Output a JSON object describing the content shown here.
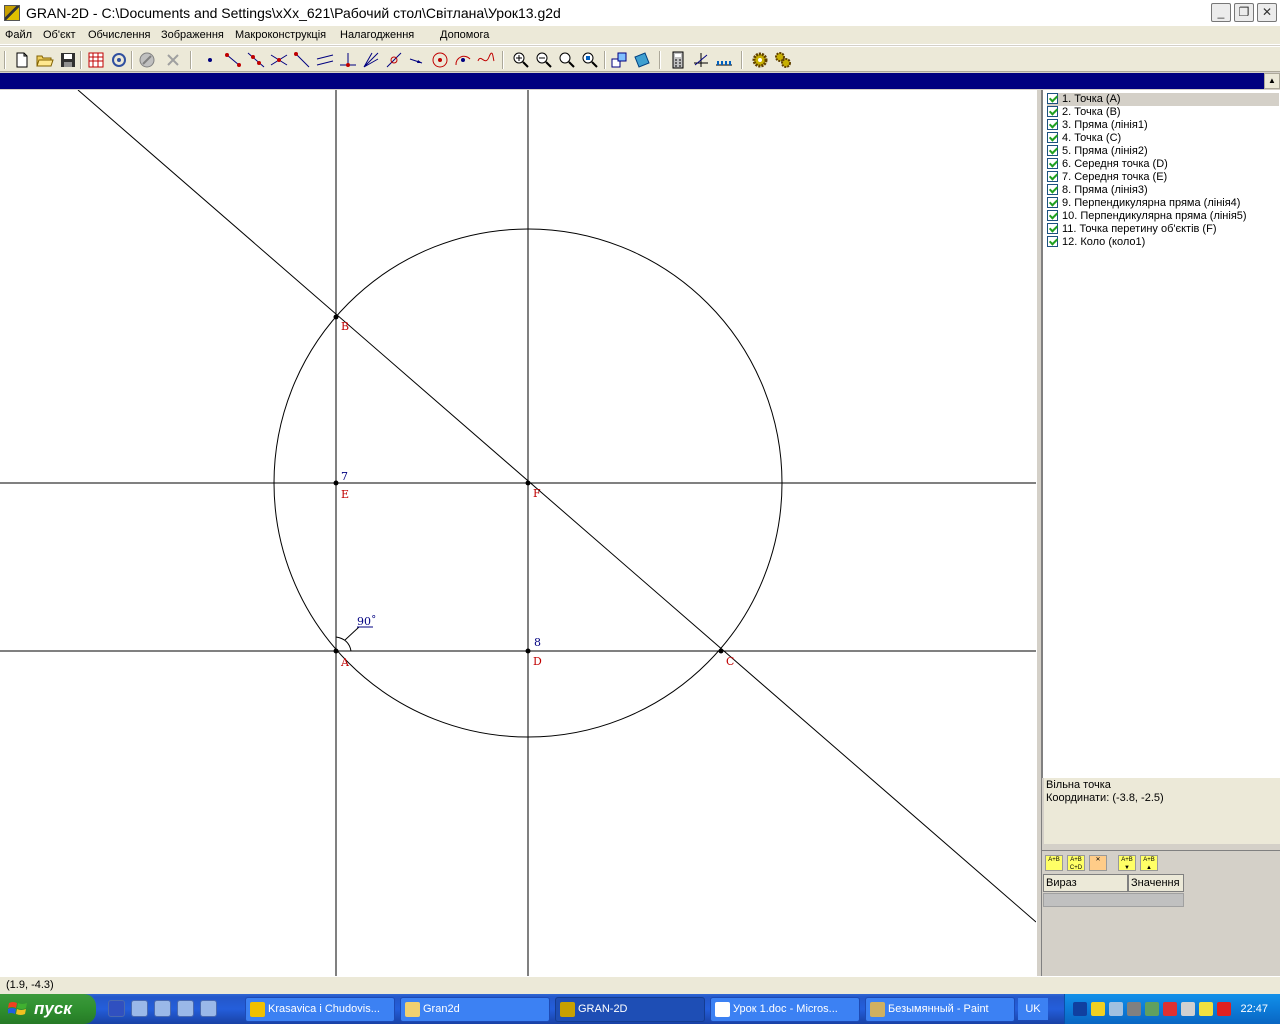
{
  "window": {
    "title": "GRAN-2D - C:\\Documents and Settings\\xXx_621\\Рабочий стол\\Світлана\\Урок13.g2d",
    "minimize_label": "_",
    "restore_label": "❐",
    "close_label": "✕"
  },
  "menu": {
    "items": [
      "Файл",
      "Об'єкт",
      "Обчислення",
      "Зображення",
      "Макроконструкція",
      "Налагодження",
      "Допомога"
    ]
  },
  "toolbar": {
    "icons": [
      "new-file-icon",
      "open-folder-icon",
      "save-icon",
      "calculator-table-icon",
      "macro-icon",
      "stop-icon",
      "scissors-icon",
      "point-icon",
      "segment-icon",
      "line-icon",
      "intersect-icon",
      "ray-icon",
      "parallel-icon",
      "perpendicular-icon",
      "bisector-icon",
      "tangent-icon",
      "vector-icon",
      "circle-icon",
      "arc-icon",
      "curve-icon",
      "zoom-in-icon",
      "zoom-out-icon",
      "zoom-icon",
      "zoom-fit-icon",
      "transform-icon",
      "region-icon",
      "calculator-icon",
      "axes-icon",
      "ruler-icon",
      "gear-icon",
      "gears-icon"
    ]
  },
  "canvas": {
    "point_labels": {
      "A": "A",
      "B": "B",
      "C": "C",
      "D": "D",
      "E": "E",
      "F": "F"
    },
    "number_labels": {
      "seven": "7",
      "eight": "8"
    },
    "angle_label": "90˚"
  },
  "objects": [
    "1. Точка (A)",
    "2. Точка (B)",
    "3. Пряма (лінія1)",
    "4. Точка (C)",
    "5. Пряма (лінія2)",
    "6. Середня точка (D)",
    "7. Середня точка (E)",
    "8. Пряма (лінія3)",
    "9. Перпендикулярна пряма (лінія4)",
    "10. Перпендикулярна пряма (лінія5)",
    "11. Точка перетину об'єктів (F)",
    "12. Коло (коло1)"
  ],
  "info": {
    "type": "Вільна точка",
    "coords": "Координати: (-3.8, -2.5)"
  },
  "expr_table": {
    "col_expr": "Вираз",
    "col_value": "Значення"
  },
  "status": {
    "cursor_coords": "(1.9, -4.3)"
  },
  "taskbar": {
    "start_label": "пуск",
    "tasks": [
      {
        "label": "Krasavica i Chudovis...",
        "active": false
      },
      {
        "label": "Gran2d",
        "active": false
      },
      {
        "label": "GRAN-2D",
        "active": true
      },
      {
        "label": "Урок 1.doc - Micros...",
        "active": false
      },
      {
        "label": "Безымянный - Paint",
        "active": false
      }
    ],
    "language": "UK",
    "clock": "22:47"
  },
  "colors": {
    "point_label": "#c00000",
    "number_label": "#000080",
    "geometry": "#000000"
  }
}
